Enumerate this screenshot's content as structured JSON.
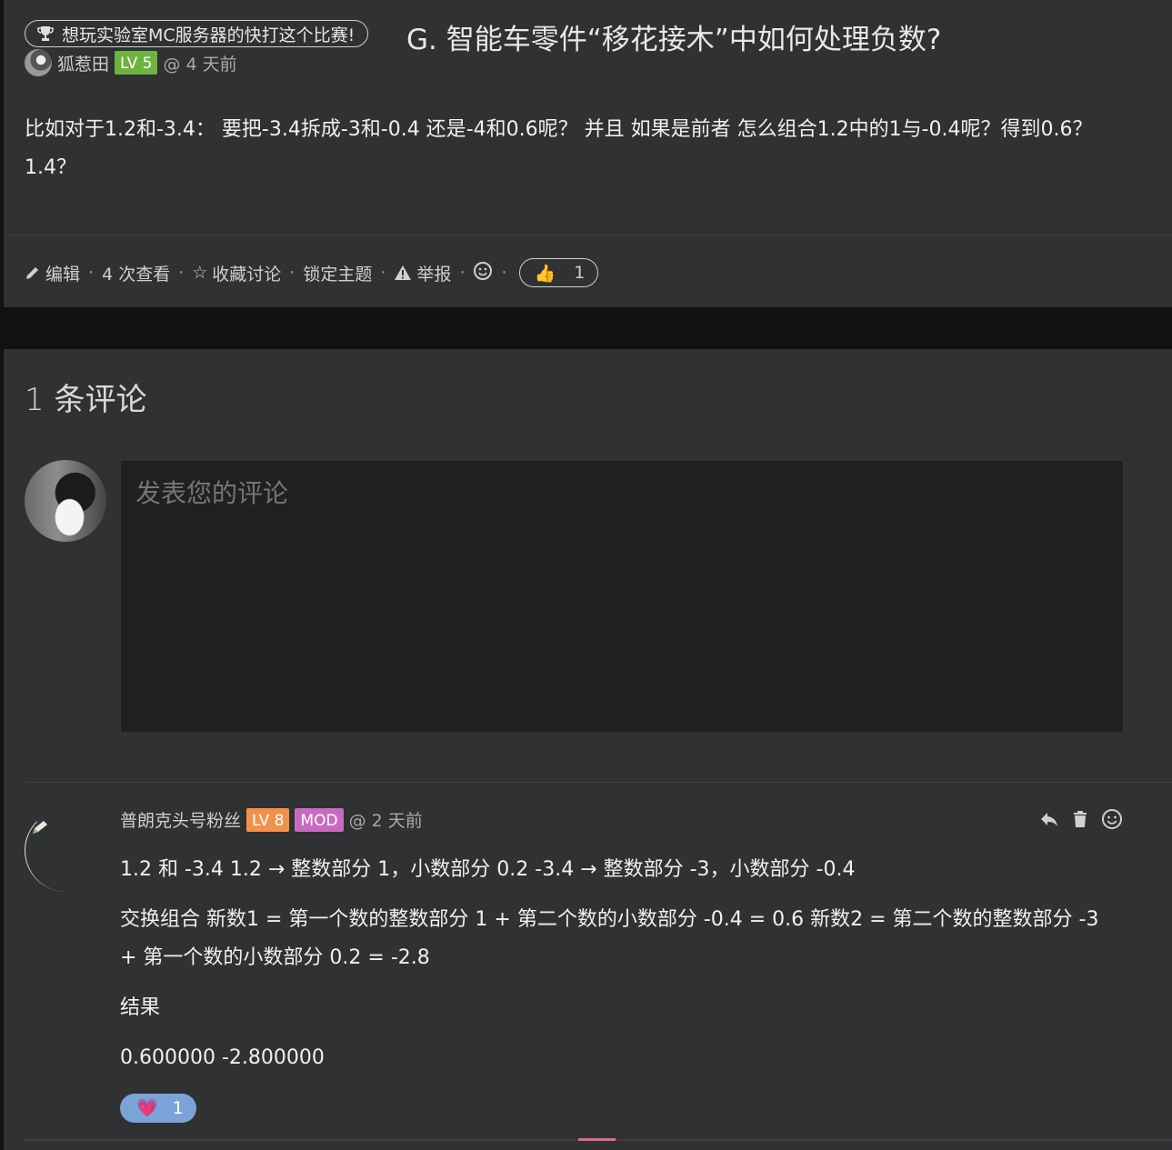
{
  "topic": {
    "promo_label": "想玩实验室MC服务器的快打这个比赛!",
    "title": "G. 智能车零件“移花接木”中如何处理负数?",
    "author": "狐惹田",
    "author_level": "LV 5",
    "time": "@ 4 天前",
    "body": "比如对于1.2和-3.4： 要把-3.4拆成-3和-0.4 还是-4和0.6呢？ 并且 如果是前者 怎么组合1.2中的1与-0.4呢？得到0.6？ 1.4？",
    "actions": {
      "edit": "编辑",
      "views": "4 次查看",
      "bookmark": "收藏讨论",
      "lock": "锁定主题",
      "report": "举报",
      "like_count": "1"
    }
  },
  "comments": {
    "heading": "1 条评论",
    "composer_placeholder": "发表您的评论",
    "items": [
      {
        "author": "普朗克头号粉丝",
        "level": "LV 8",
        "role": "MOD",
        "time": "@ 2 天前",
        "paragraphs": [
          "1.2 和 -3.4 1.2 → 整数部分 1，小数部分 0.2 -3.4 → 整数部分 -3，小数部分 -0.4",
          "交换组合 新数1 = 第一个数的整数部分 1 + 第二个数的小数部分 -0.4 = 0.6 新数2 = 第二个数的整数部分 -3 + 第一个数的小数部分 0.2 = -2.8",
          "结果",
          "0.600000 -2.800000"
        ],
        "reaction_count": "1"
      }
    ]
  }
}
